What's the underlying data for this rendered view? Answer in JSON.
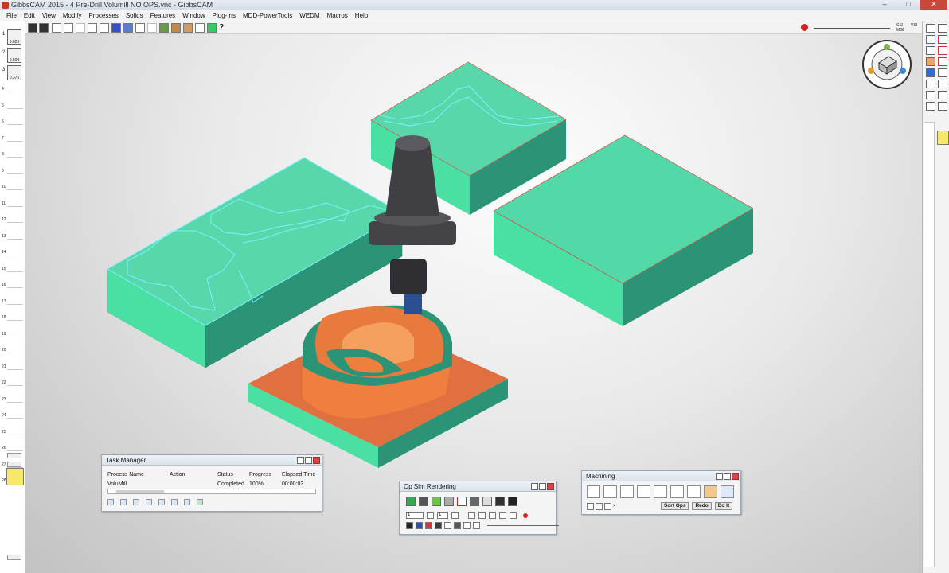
{
  "window": {
    "title": "GibbsCAM 2015 - 4 Pre-Drill Volumill NO OPS.vnc - GibbsCAM",
    "minimize": "–",
    "maximize": "□",
    "close": "✕"
  },
  "menu": [
    "File",
    "Edit",
    "View",
    "Modify",
    "Processes",
    "Solids",
    "Features",
    "Window",
    "Plug-Ins",
    "MDD-PowerTools",
    "WEDM",
    "Macros",
    "Help"
  ],
  "toolbar": {
    "help": "?",
    "csi": "CSI",
    "mgi": "MGI",
    "vsi": "VSI"
  },
  "tool_list": [
    {
      "number": "1",
      "size": "0.625"
    },
    {
      "number": "2",
      "size": "0.500"
    },
    {
      "number": "3",
      "size": "0.375"
    }
  ],
  "ruler_numbers": [
    "4",
    "5",
    "6",
    "7",
    "8",
    "9",
    "10",
    "11",
    "12",
    "13",
    "14",
    "15",
    "16",
    "17",
    "18",
    "19",
    "20",
    "21",
    "22",
    "23",
    "24",
    "25",
    "26",
    "27",
    "28"
  ],
  "task_manager": {
    "title": "Task Manager",
    "columns": [
      "Process Name",
      "Action",
      "Status",
      "Progress",
      "Elapsed Time"
    ],
    "rows": [
      {
        "process_name": "VoluMill",
        "action": "",
        "status": "Completed",
        "progress": "100%",
        "elapsed": "00:00:03"
      }
    ]
  },
  "op_sim": {
    "title": "Op Sim Rendering",
    "op_number": "1",
    "step": "1"
  },
  "machining": {
    "title": "Machining",
    "sort_ops": "Sort Ops",
    "redo": "Redo",
    "do_it": "Do It"
  },
  "colors": {
    "stock_top": "#4fd8a6",
    "stock_side_light": "#4ae0a4",
    "stock_side_dark": "#2b9476",
    "toolpath": "#7af2ff",
    "part_orange": "#f07e3e",
    "holder_dark": "#3c3c40"
  },
  "icons": [
    "view-cube-icon",
    "record-icon",
    "play-icon",
    "rewind-icon",
    "stop-icon"
  ]
}
